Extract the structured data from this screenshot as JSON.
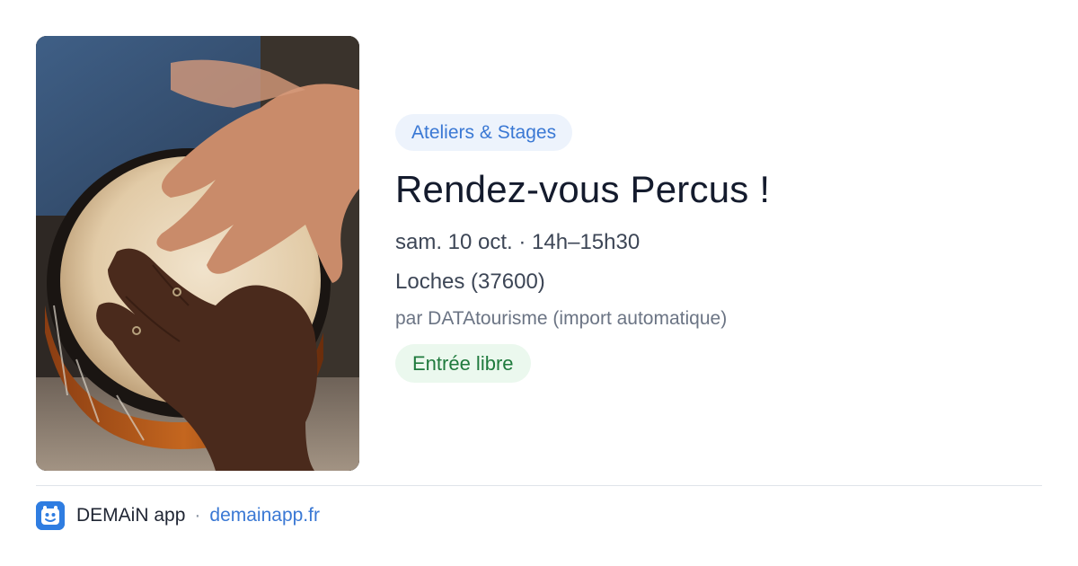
{
  "event": {
    "category": "Ateliers & Stages",
    "title": "Rendez-vous Percus !",
    "date_time": "sam. 10 oct. · 14h–15h30",
    "location": "Loches (37600)",
    "source": "par DATAtourisme (import automatique)",
    "price": "Entrée libre",
    "image_description_icon": "djembe-photo"
  },
  "footer": {
    "app_name": "DEMAiN app",
    "separator": "·",
    "domain": "demainapp.fr",
    "logo_icon": "demain-logo-icon"
  },
  "colors": {
    "category_bg": "#edf3fc",
    "category_text": "#3a78d4",
    "title_text": "#141b2d",
    "price_bg": "#ebf8ee",
    "price_text": "#1f7a3d",
    "link": "#3a78d4",
    "logo_bg": "#2f7de1"
  }
}
